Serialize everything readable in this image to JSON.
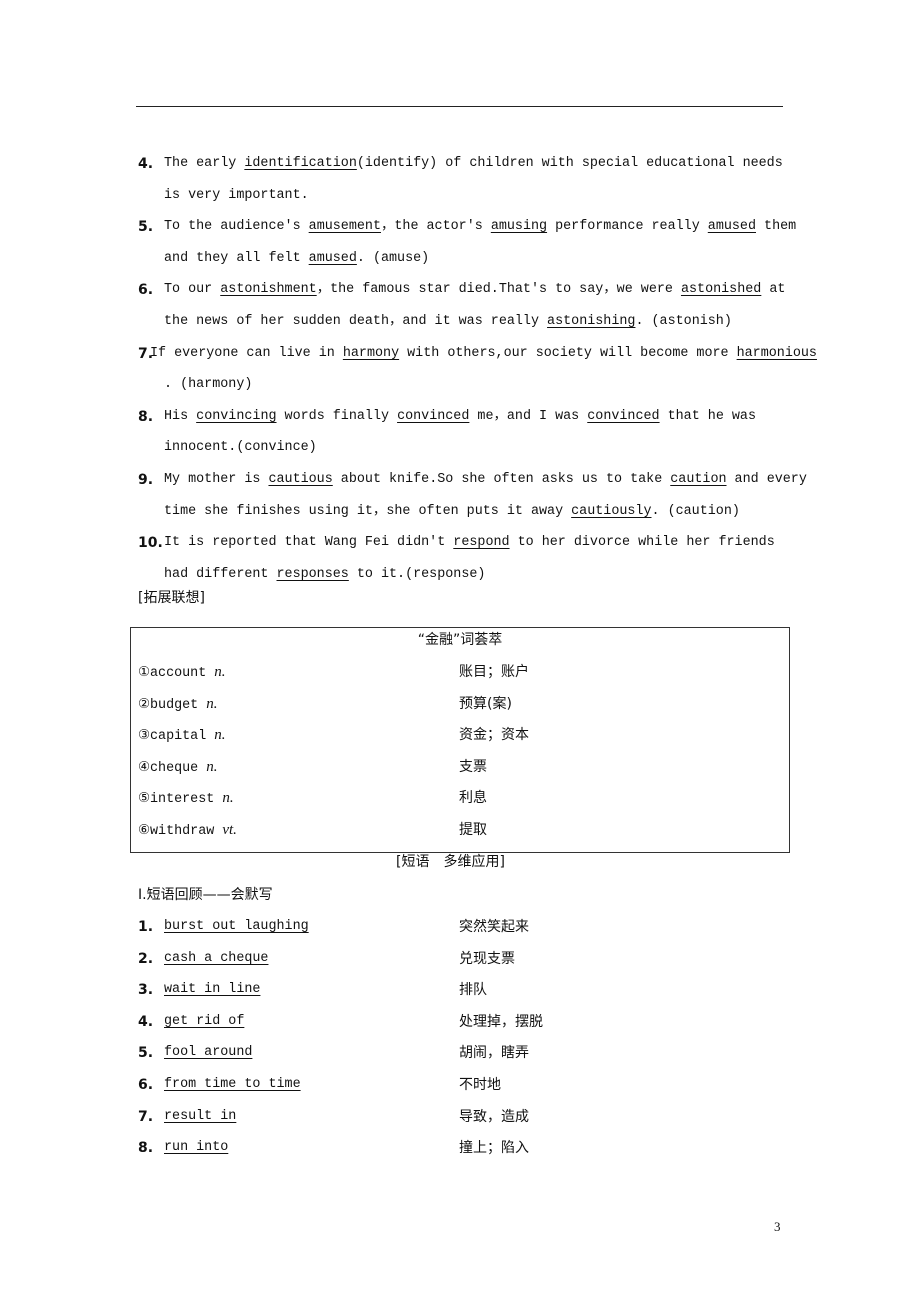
{
  "exercises": [
    {
      "num": "4.",
      "lines": [
        [
          {
            "t": "The early "
          },
          {
            "t": "identification",
            "u": 1
          },
          {
            "t": "(identify) of children with special educational needs"
          }
        ],
        [
          {
            "t": "is very important."
          }
        ]
      ]
    },
    {
      "num": "5.",
      "lines": [
        [
          {
            "t": "To the audience's "
          },
          {
            "t": "amusement",
            "u": 1
          },
          {
            "t": "，the actor's "
          },
          {
            "t": "amusing",
            "u": 1
          },
          {
            "t": " performance really "
          },
          {
            "t": "amused",
            "u": 1
          },
          {
            "t": " them"
          }
        ],
        [
          {
            "t": "and they all felt "
          },
          {
            "t": "amused",
            "u": 1
          },
          {
            "t": ". (amuse)"
          }
        ]
      ]
    },
    {
      "num": "6.",
      "lines": [
        [
          {
            "t": "To our "
          },
          {
            "t": "astonishment",
            "u": 1
          },
          {
            "t": "，the famous star died.That's to say，we were "
          },
          {
            "t": "astonished",
            "u": 1
          },
          {
            "t": " at"
          }
        ],
        [
          {
            "t": "the news of her sudden death，and it was really "
          },
          {
            "t": "astonishing",
            "u": 1
          },
          {
            "t": ". (astonish)"
          }
        ]
      ]
    },
    {
      "num": "7.",
      "lines": [
        [
          {
            "t": "If everyone can live in "
          },
          {
            "t": "harmony",
            "u": 1
          },
          {
            "t": " with others,our society will become more "
          },
          {
            "t": "harmonious",
            "u": 1
          }
        ],
        [
          {
            "t": ". (harmony)"
          }
        ]
      ]
    },
    {
      "num": "8.",
      "lines": [
        [
          {
            "t": "His "
          },
          {
            "t": "convincing",
            "u": 1
          },
          {
            "t": " words finally "
          },
          {
            "t": "convinced",
            "u": 1
          },
          {
            "t": " me，and I was "
          },
          {
            "t": "convinced",
            "u": 1
          },
          {
            "t": " that he was"
          }
        ],
        [
          {
            "t": "innocent.(convince)"
          }
        ]
      ]
    },
    {
      "num": "9.",
      "lines": [
        [
          {
            "t": "My mother is "
          },
          {
            "t": "cautious",
            "u": 1
          },
          {
            "t": " about knife.So she often asks us to take "
          },
          {
            "t": "caution",
            "u": 1
          },
          {
            "t": " and every"
          }
        ],
        [
          {
            "t": "time she finishes using it，she often puts it away "
          },
          {
            "t": "cautiously",
            "u": 1
          },
          {
            "t": ". (caution)"
          }
        ]
      ]
    },
    {
      "num": "10.",
      "lines": [
        [
          {
            "t": "It is reported that Wang Fei didn't "
          },
          {
            "t": "respond",
            "u": 1
          },
          {
            "t": " to her divorce while her friends"
          }
        ],
        [
          {
            "t": "had different "
          },
          {
            "t": "responses",
            "u": 1
          },
          {
            "t": " to it.(response)"
          }
        ]
      ]
    }
  ],
  "expand_heading": "[拓展联想]",
  "vocab_box": {
    "title": "“金融”词荟萃",
    "rows": [
      {
        "term": "①account ",
        "pos": "n.",
        "meaning": "账目；账户"
      },
      {
        "term": "②budget ",
        "pos": "n.",
        "meaning": "预算(案)"
      },
      {
        "term": "③capital ",
        "pos": "n.",
        "meaning": "资金；资本"
      },
      {
        "term": "④cheque ",
        "pos": "n.",
        "meaning": "支票"
      },
      {
        "term": "⑤interest ",
        "pos": "n.",
        "meaning": "利息"
      },
      {
        "term": "⑥withdraw ",
        "pos": "vt.",
        "meaning": "提取"
      }
    ]
  },
  "phrase_heading": "[短语　多维应用]",
  "phrase_subheading": "Ⅰ.短语回顾——会默写",
  "phrases": [
    {
      "num": "1.",
      "phrase": "burst out laughing",
      "meaning": "突然笑起来"
    },
    {
      "num": "2.",
      "phrase": "cash a cheque",
      "meaning": "兑现支票"
    },
    {
      "num": "3.",
      "phrase": "wait in line",
      "meaning": "排队"
    },
    {
      "num": "4.",
      "phrase": "get rid of",
      "meaning": "处理掉，摆脱"
    },
    {
      "num": "5.",
      "phrase": "fool around",
      "meaning": "胡闹，瞎弄"
    },
    {
      "num": "6.",
      "phrase": "from time to time",
      "meaning": "不时地"
    },
    {
      "num": "7.",
      "phrase": "result in",
      "meaning": "导致，造成"
    },
    {
      "num": "8.",
      "phrase": "run into",
      "meaning": "撞上；陷入"
    }
  ],
  "page_number": "3"
}
